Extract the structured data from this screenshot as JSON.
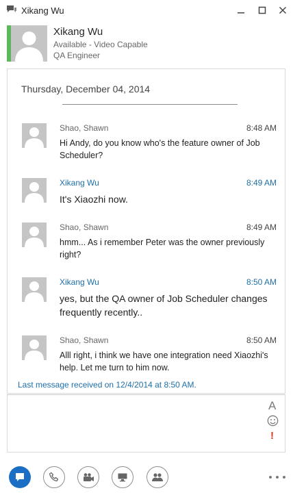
{
  "window": {
    "title": "Xikang Wu",
    "controls": [
      "minimize-icon",
      "maximize-icon",
      "close-icon"
    ]
  },
  "contact": {
    "name": "Xikang Wu",
    "status": "Available - Video Capable",
    "job_title": "QA Engineer",
    "presence_color": "#5cb85c"
  },
  "conversation": {
    "date": "Thursday, December 04, 2014",
    "messages": [
      {
        "sender": "Shao, Shawn",
        "time": "8:48 AM",
        "text": "Hi Andy, do you know who's the feature owner of Job Scheduler?",
        "self": false
      },
      {
        "sender": "Xikang Wu",
        "time": "8:49 AM",
        "text": "It's Xiaozhi now.",
        "self": true
      },
      {
        "sender": "Shao, Shawn",
        "time": "8:49 AM",
        "text": "hmm... As i remember Peter was the owner previously right?",
        "self": false
      },
      {
        "sender": "Xikang Wu",
        "time": "8:50 AM",
        "text": "yes, but the QA owner of Job Scheduler changes frequently recently..",
        "self": true
      },
      {
        "sender": "Shao, Shawn",
        "time": "8:50 AM",
        "text": "Alll right, i think we have one integration need Xiaozhi's help. Let me turn to him now.",
        "self": false
      }
    ],
    "last_received": "Last message received on 12/4/2014 at 8:50 AM."
  },
  "compose": {
    "placeholder": "",
    "font_label": "A",
    "importance_label": "!"
  },
  "toolbar": {
    "buttons": [
      "im-icon",
      "phone-icon",
      "video-icon",
      "present-icon",
      "participants-icon"
    ],
    "more": "more-options-icon"
  },
  "colors": {
    "accent": "#1a6fc4",
    "link": "#1e6fa8",
    "importance": "#e0301e"
  }
}
